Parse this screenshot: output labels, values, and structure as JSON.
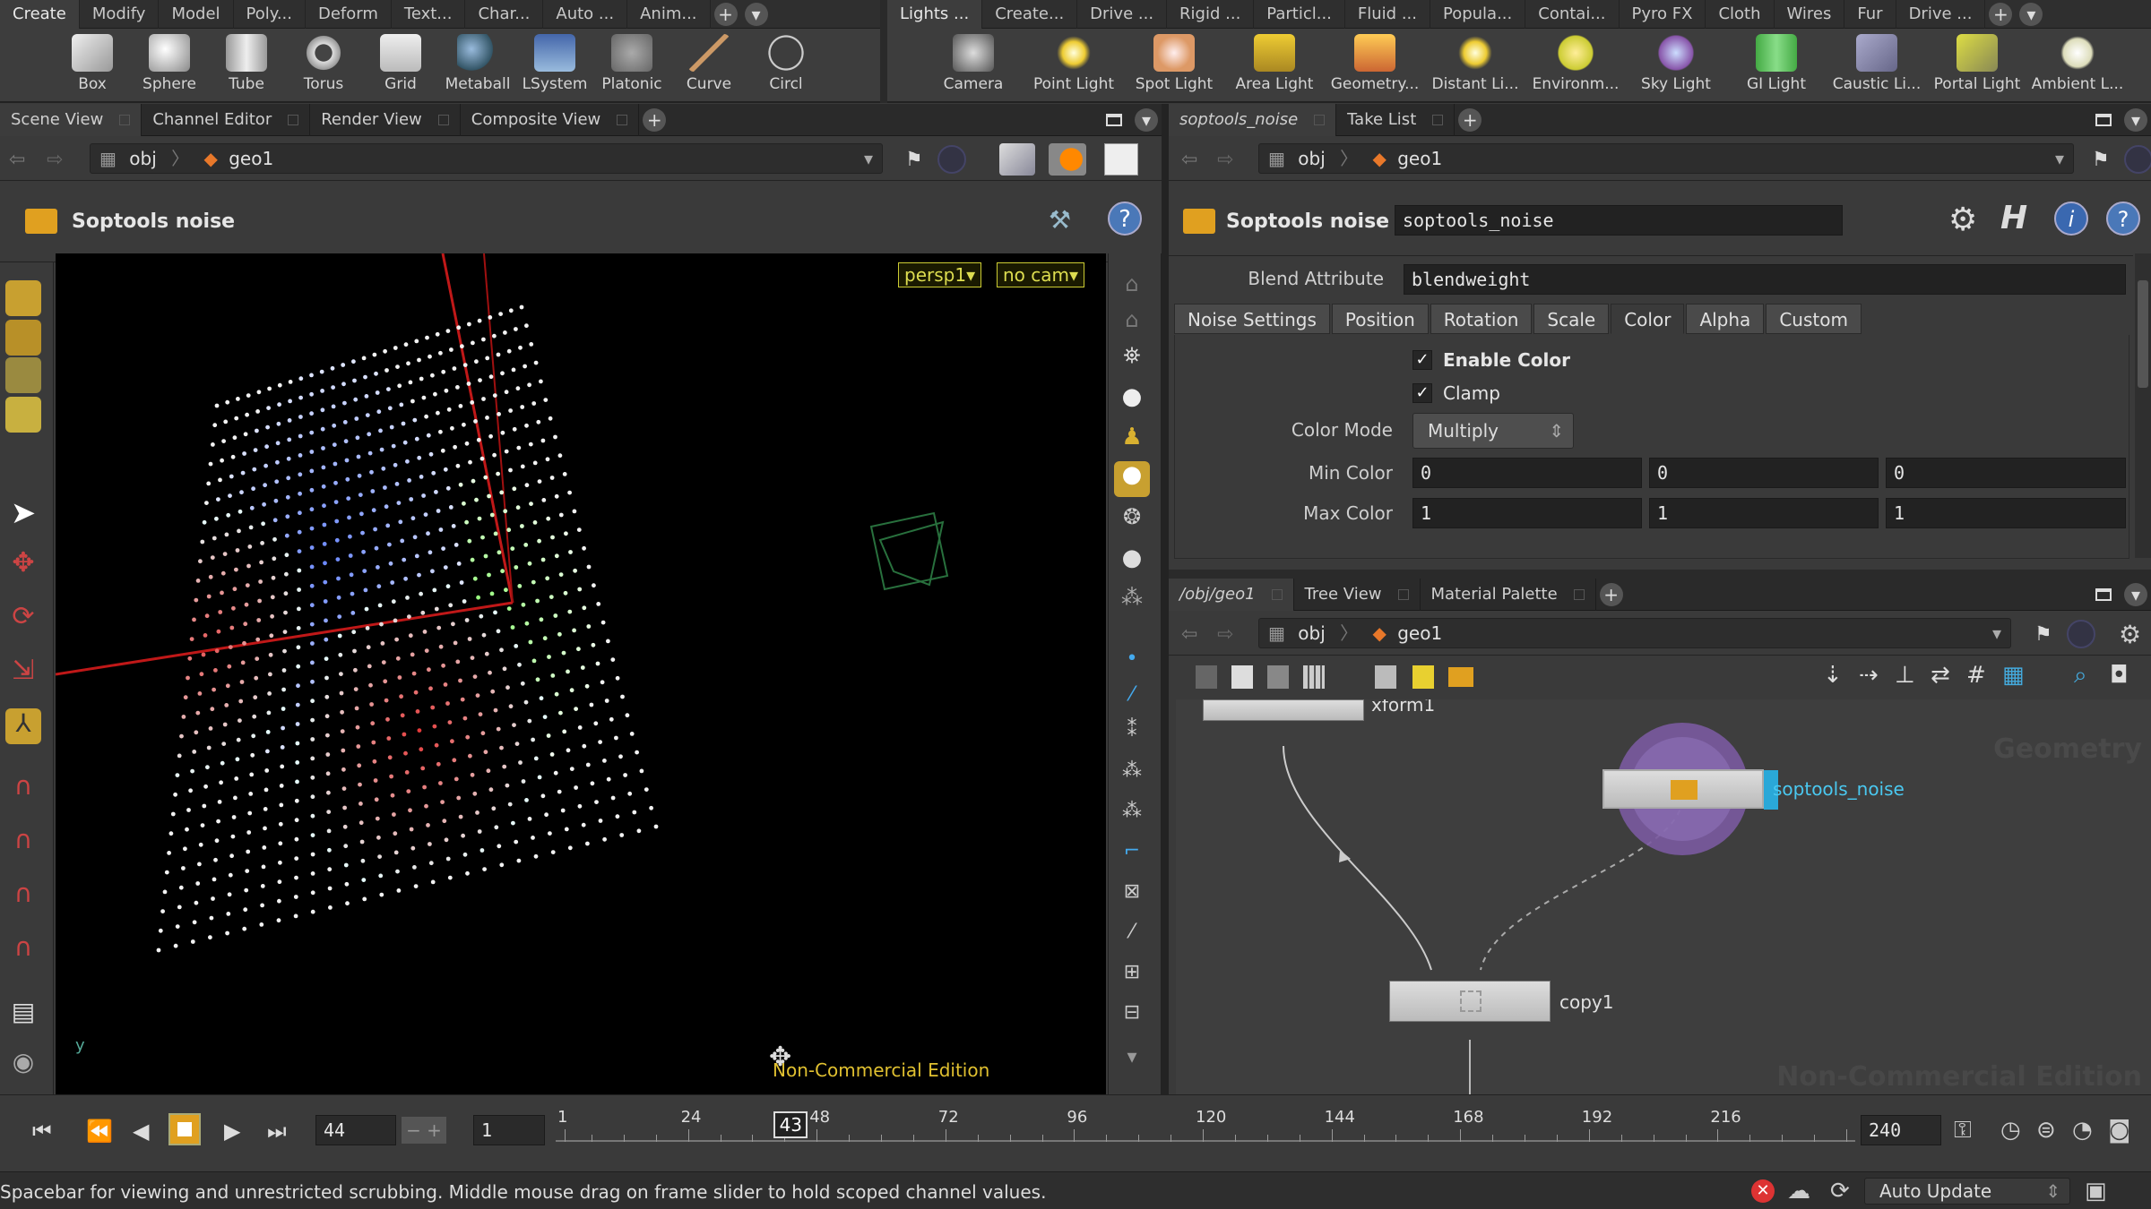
{
  "shelf_left": {
    "tabs": [
      "Create",
      "Modify",
      "Model",
      "Poly...",
      "Deform",
      "Text...",
      "Char...",
      "Auto ...",
      "Anim..."
    ],
    "tools": [
      {
        "label": "Box",
        "icon": "box-icon"
      },
      {
        "label": "Sphere",
        "icon": "sphere-icon"
      },
      {
        "label": "Tube",
        "icon": "tube-icon"
      },
      {
        "label": "Torus",
        "icon": "torus-icon"
      },
      {
        "label": "Grid",
        "icon": "grid-icon"
      },
      {
        "label": "Metaball",
        "icon": "metaball-icon"
      },
      {
        "label": "LSystem",
        "icon": "lsystem-icon"
      },
      {
        "label": "Platonic ...",
        "icon": "platonic-icon"
      },
      {
        "label": "Curve",
        "icon": "curve-icon"
      },
      {
        "label": "Circl",
        "icon": "circle-icon"
      }
    ]
  },
  "shelf_right": {
    "tabs": [
      "Lights ...",
      "Create...",
      "Drive ...",
      "Rigid ...",
      "Particl...",
      "Fluid ...",
      "Popula...",
      "Contai...",
      "Pyro FX",
      "Cloth",
      "Wires",
      "Fur",
      "Drive ..."
    ],
    "tools": [
      {
        "label": "Camera",
        "icon": "camera-icon"
      },
      {
        "label": "Point Light",
        "icon": "point-light-icon"
      },
      {
        "label": "Spot Light",
        "icon": "spot-light-icon"
      },
      {
        "label": "Area Light",
        "icon": "area-light-icon"
      },
      {
        "label": "Geometry...",
        "icon": "geometry-light-icon"
      },
      {
        "label": "Distant Li...",
        "icon": "distant-light-icon"
      },
      {
        "label": "Environm...",
        "icon": "environment-light-icon"
      },
      {
        "label": "Sky Light",
        "icon": "sky-light-icon"
      },
      {
        "label": "GI Light",
        "icon": "gi-light-icon"
      },
      {
        "label": "Caustic Li...",
        "icon": "caustic-light-icon"
      },
      {
        "label": "Portal Light",
        "icon": "portal-light-icon"
      },
      {
        "label": "Ambient L...",
        "icon": "ambient-light-icon"
      }
    ]
  },
  "left_pane": {
    "tabs": [
      "Scene View",
      "Channel Editor",
      "Render View",
      "Composite View"
    ],
    "path": {
      "root": "obj",
      "node": "geo1"
    },
    "title": "Soptools noise",
    "camera_menu": "persp1▾",
    "cam_menu": "no cam▾",
    "watermark": "Non-Commercial Edition"
  },
  "params_pane": {
    "tabs": [
      "soptools_noise",
      "Take List"
    ],
    "path": {
      "root": "obj",
      "node": "geo1"
    },
    "node_type": "Soptools noise",
    "node_name": "soptools_noise",
    "blend_attribute_label": "Blend Attribute",
    "blend_attribute_value": "blendweight",
    "subtabs": [
      "Noise Settings",
      "Position",
      "Rotation",
      "Scale",
      "Color",
      "Alpha",
      "Custom"
    ],
    "active_subtab": "Color",
    "enable_color_label": "Enable Color",
    "clamp_label": "Clamp",
    "color_mode_label": "Color Mode",
    "color_mode_value": "Multiply",
    "min_color_label": "Min Color",
    "min_color": [
      "0",
      "0",
      "0"
    ],
    "max_color_label": "Max Color",
    "max_color": [
      "1",
      "1",
      "1"
    ]
  },
  "network_pane": {
    "tabs": [
      "/obj/geo1",
      "Tree View",
      "Material Palette"
    ],
    "path": {
      "root": "obj",
      "node": "geo1"
    },
    "nodes": {
      "top": "xform1",
      "noise": "soptools_noise",
      "copy": "copy1"
    },
    "watermark_context": "Geometry",
    "watermark": "Non-Commercial Edition"
  },
  "timeline": {
    "current_frame": "44",
    "start_frame": "1",
    "end_frame": "240",
    "playhead_label": "43",
    "ticks": [
      "1",
      "24",
      "48",
      "72",
      "96",
      "120",
      "144",
      "168",
      "192",
      "216"
    ]
  },
  "status": {
    "message": "Spacebar for viewing and unrestricted scrubbing. Middle mouse drag on frame slider to hold scoped channel values.",
    "update_mode": "Auto Update"
  },
  "colors": {
    "accent": "#e0a020",
    "node_select": "#2aa8d8",
    "viewport_bg": "#000000"
  }
}
